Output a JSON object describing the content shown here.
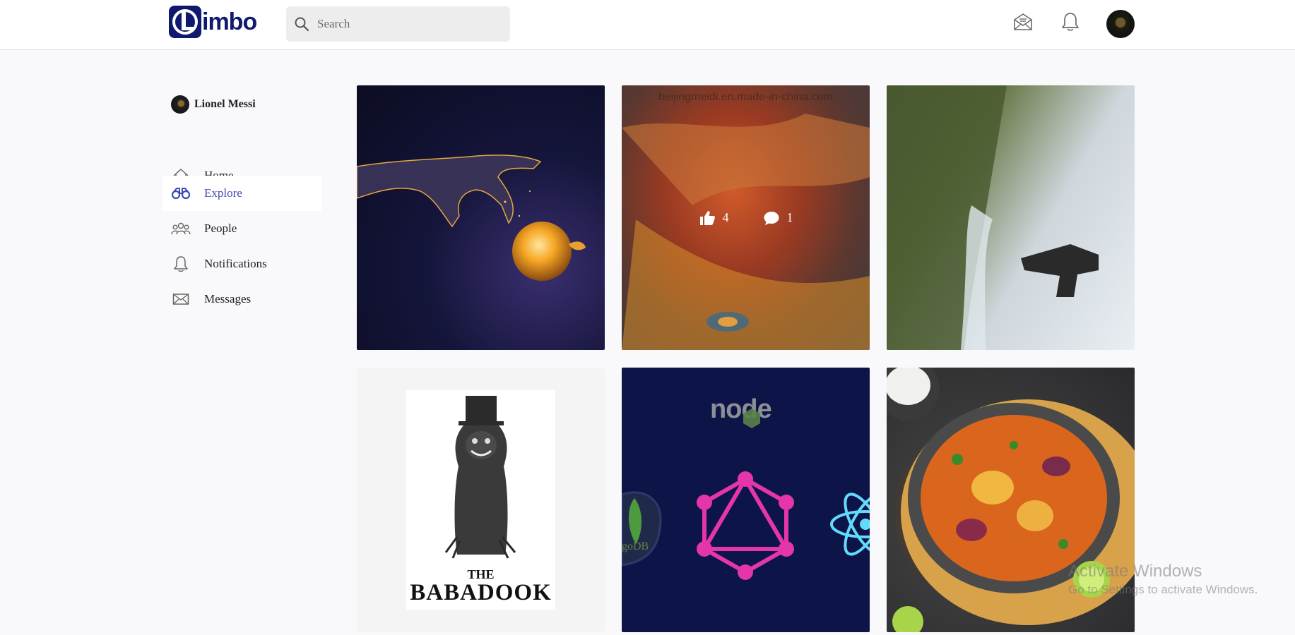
{
  "app": {
    "name": "Limbo",
    "logo_letter": "L",
    "logo_rest": "imbo"
  },
  "header": {
    "search_placeholder": "Search",
    "icons": [
      "search-icon",
      "messages-icon",
      "bell-icon",
      "avatar"
    ]
  },
  "sidebar": {
    "profile_name": "Lionel Messi",
    "items": [
      {
        "label": "Home",
        "icon": "home-icon",
        "active": false
      },
      {
        "label": "Explore",
        "icon": "binoculars-icon",
        "active": true
      },
      {
        "label": "People",
        "icon": "people-icon",
        "active": false
      },
      {
        "label": "Notifications",
        "icon": "bell-icon",
        "active": false
      },
      {
        "label": "Messages",
        "icon": "envelope-icon",
        "active": false
      }
    ]
  },
  "grid": {
    "hovered_post": {
      "likes": "4",
      "comments": "1",
      "watermark": "beijingmeidi.en.made-in-china.com"
    },
    "poster": {
      "the": "THE",
      "title": "BABADOOK"
    },
    "tech": {
      "node": "node",
      "mongo": "goDB"
    }
  },
  "system": {
    "activate_title": "Activate Windows",
    "activate_sub": "Go to Settings to activate Windows."
  },
  "colors": {
    "brand": "#0f1a6e",
    "active_nav": "#3f4bb5",
    "background": "#f9f9fb"
  }
}
